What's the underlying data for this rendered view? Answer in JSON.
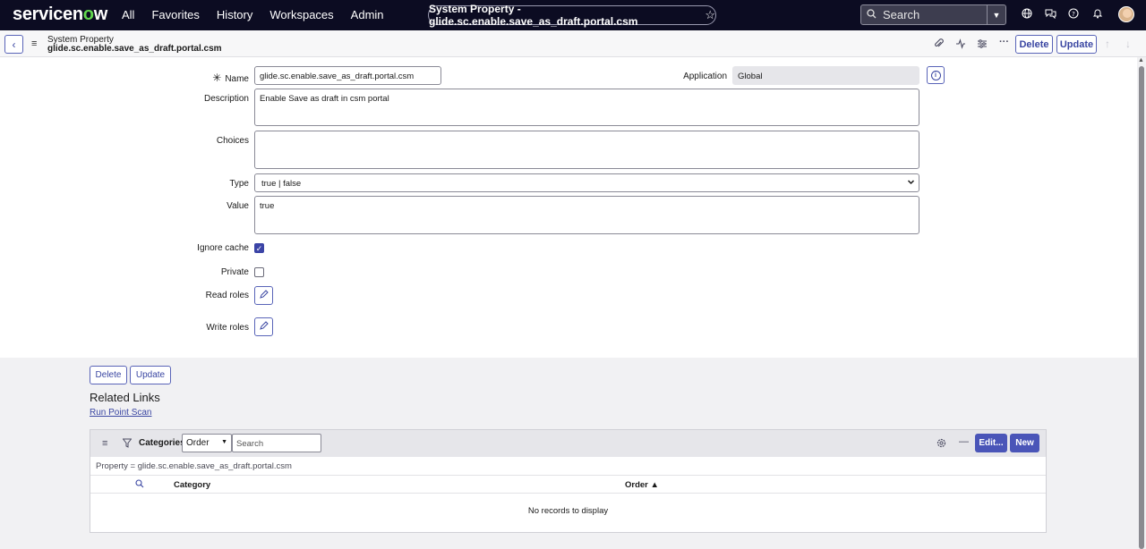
{
  "nav": {
    "logo_pre": "servicen",
    "logo_o": "o",
    "logo_post": "w",
    "links": [
      "All",
      "Favorites",
      "History",
      "Workspaces",
      "Admin"
    ],
    "title_pill": "System Property - glide.sc.enable.save_as_draft.portal.csm",
    "search_placeholder": "Search"
  },
  "form_header": {
    "table_label": "System Property",
    "record_name": "glide.sc.enable.save_as_draft.portal.csm",
    "delete_label": "Delete",
    "update_label": "Update"
  },
  "form": {
    "name_label": "Name",
    "name_value": "glide.sc.enable.save_as_draft.portal.csm",
    "application_label": "Application",
    "application_value": "Global",
    "description_label": "Description",
    "description_value": "Enable Save as draft in csm portal",
    "choices_label": "Choices",
    "choices_value": "",
    "type_label": "Type",
    "type_value": "true | false",
    "value_label": "Value",
    "value_value": "true",
    "ignore_cache_label": "Ignore cache",
    "ignore_cache_checked": true,
    "private_label": "Private",
    "private_checked": false,
    "read_roles_label": "Read roles",
    "write_roles_label": "Write roles"
  },
  "bottom": {
    "delete_label": "Delete",
    "update_label": "Update",
    "related_links_heading": "Related Links",
    "run_point_scan_link": "Run Point Scan"
  },
  "related_list": {
    "title": "Categories",
    "order_select_value": "Order",
    "search_placeholder": "Search",
    "edit_label": "Edit...",
    "new_label": "New",
    "filter_text": "Property = glide.sc.enable.save_as_draft.portal.csm",
    "columns": [
      "Category",
      "Order ▲"
    ],
    "empty_message": "No records to display"
  },
  "colors": {
    "nav_bg": "#0c0c22",
    "accent": "#3a46a2",
    "primary_button": "#4a55b8",
    "logo_green": "#62d84e"
  }
}
